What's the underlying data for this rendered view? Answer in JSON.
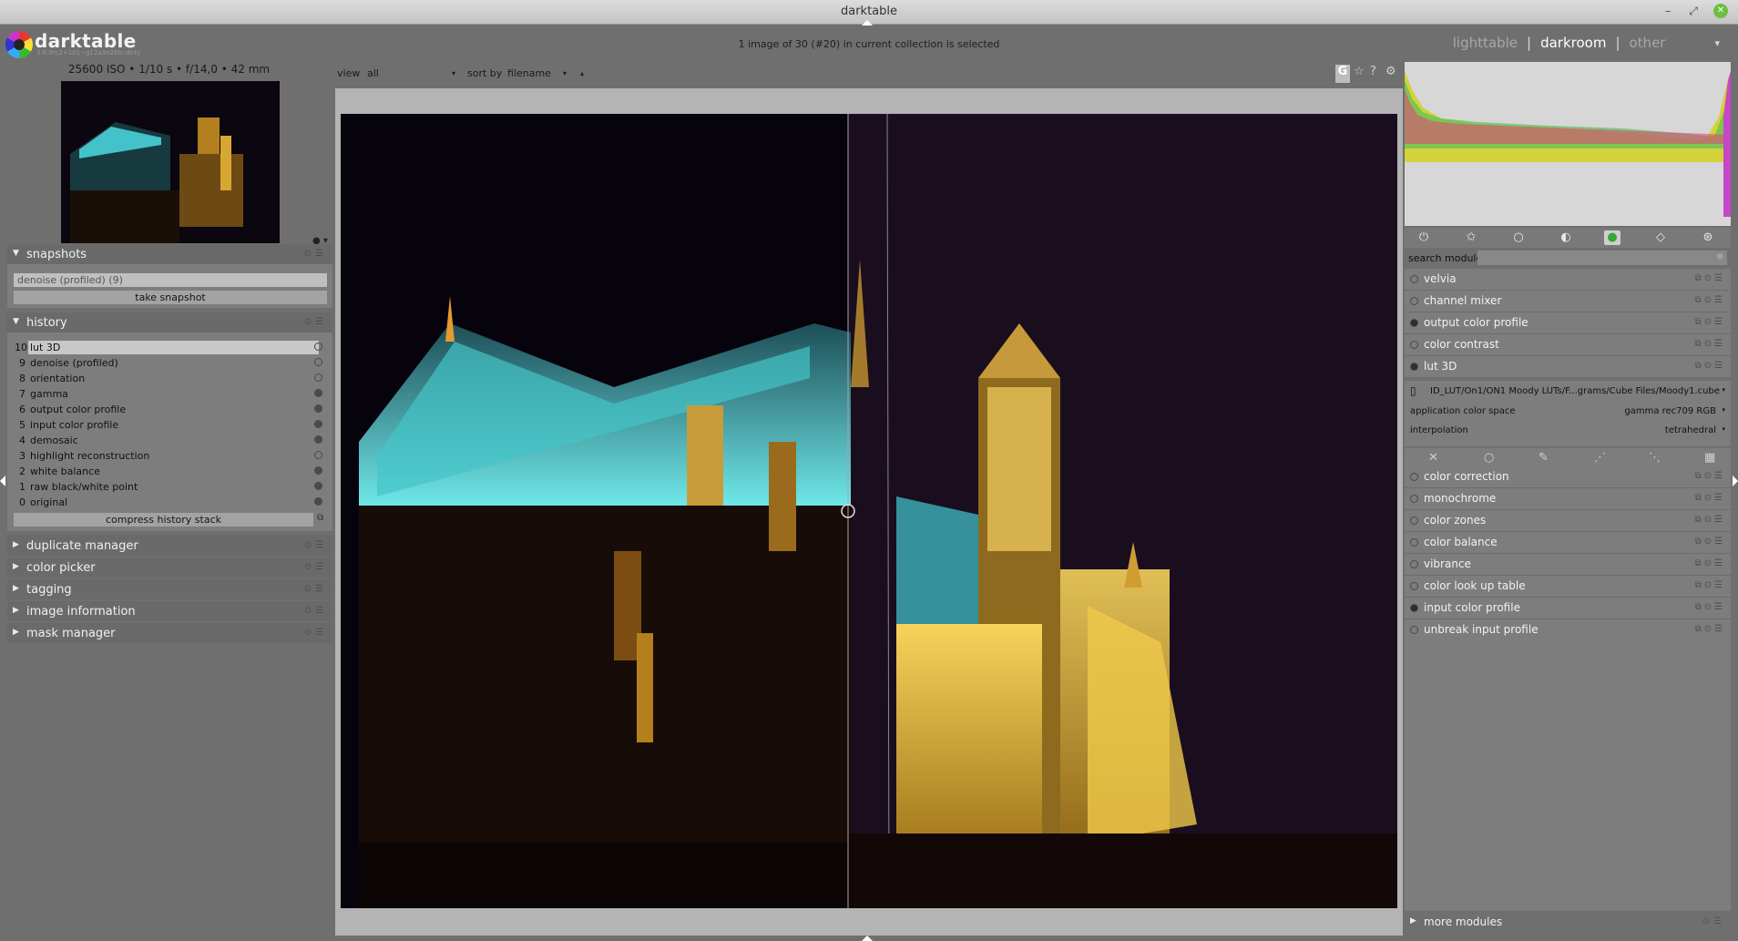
{
  "window": {
    "title": "darktable"
  },
  "header": {
    "app_name": "darktable",
    "version": "3.6.0rc2+101~g12a3e26fc-dirty",
    "collection_info": "1 image of 30 (#20) in current collection is selected",
    "views": {
      "lighttable": "lighttable",
      "darkroom": "darkroom",
      "other": "other",
      "sep": "|",
      "menu": "▾"
    }
  },
  "left": {
    "exif": "25600 ISO • 1/10 s • f/14,0 • 42 mm",
    "snapshots": {
      "title": "snapshots",
      "current": "denoise (profiled) (9)",
      "take_snapshot": "take snapshot"
    },
    "history": {
      "title": "history",
      "items": [
        {
          "num": "10",
          "name": "lut 3D"
        },
        {
          "num": "9",
          "name": "denoise (profiled)"
        },
        {
          "num": "8",
          "name": "orientation"
        },
        {
          "num": "7",
          "name": "gamma"
        },
        {
          "num": "6",
          "name": "output color profile"
        },
        {
          "num": "5",
          "name": "input color profile"
        },
        {
          "num": "4",
          "name": "demosaic"
        },
        {
          "num": "3",
          "name": "highlight reconstruction"
        },
        {
          "num": "2",
          "name": "white balance"
        },
        {
          "num": "1",
          "name": "raw black/white point"
        },
        {
          "num": "0",
          "name": "original"
        }
      ],
      "compress": "compress history stack"
    },
    "modules": {
      "duplicate": "duplicate manager",
      "color_picker": "color picker",
      "tagging": "tagging",
      "image_info": "image information",
      "mask_manager": "mask manager"
    }
  },
  "center": {
    "view_label": "view",
    "view_value": "all",
    "sort_label": "sort by",
    "sort_value": "filename",
    "g_button": "G",
    "help": "?"
  },
  "right": {
    "search_label": "search module",
    "search_placeholder": "",
    "modules": {
      "velvia": "velvia",
      "channel_mixer": "channel mixer",
      "output_color_profile": "output color profile",
      "color_contrast": "color contrast",
      "lut3d": "lut 3D",
      "color_correction": "color correction",
      "monochrome": "monochrome",
      "color_zones": "color zones",
      "color_balance": "color balance",
      "vibrance": "vibrance",
      "color_lookup_table": "color look up table",
      "input_color_profile": "input color profile",
      "unbreak_input_profile": "unbreak input profile"
    },
    "lut3d": {
      "file": "ID_LUT/On1/ON1 Moody LUTs/F...grams/Cube Files/Moody1.cube",
      "app_cs_label": "application color space",
      "app_cs_value": "gamma rec709 RGB",
      "interp_label": "interpolation",
      "interp_value": "tetrahedral"
    },
    "more_modules": "more modules"
  },
  "colors": {
    "panel": "#7d7d7d",
    "header_bg": "#6f6f6f",
    "canvas": "#b4b4b4"
  }
}
